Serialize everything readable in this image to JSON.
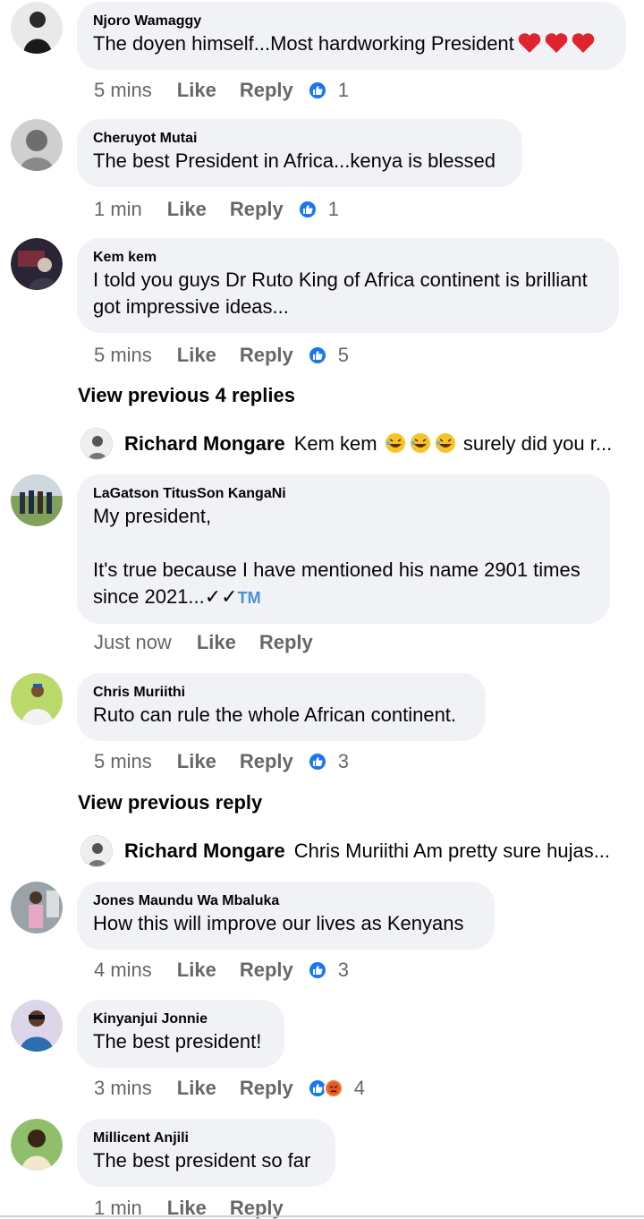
{
  "comments": [
    {
      "name": "Njoro Wamaggy",
      "text": "The doyen himself...Most hardworking President",
      "time": "5 mins",
      "like": "Like",
      "reply": "Reply",
      "reaction_count": "1"
    },
    {
      "name": "Cheruyot Mutai",
      "text": "The best President in Africa...kenya is blessed",
      "time": "1 min",
      "like": "Like",
      "reply": "Reply",
      "reaction_count": "1"
    },
    {
      "name": "Kem kem",
      "text": "I told you guys Dr Ruto King of Africa continent is brilliant got impressive ideas...",
      "time": "5 mins",
      "like": "Like",
      "reply": "Reply",
      "reaction_count": "5"
    },
    {
      "name": "LaGatson TitusSon KangaNi",
      "text": "My president,\n\nIt's true because I have mentioned his name 2901 times since 2021...✓✓",
      "tm": "TM",
      "time": "Just now",
      "like": "Like",
      "reply": "Reply"
    },
    {
      "name": "Chris Muriithi",
      "text": "Ruto can rule the whole African continent.",
      "time": "5 mins",
      "like": "Like",
      "reply": "Reply",
      "reaction_count": "3"
    },
    {
      "name": "Jones Maundu Wa Mbaluka",
      "text": "How  this will improve our lives as Kenyans",
      "time": "4 mins",
      "like": "Like",
      "reply": "Reply",
      "reaction_count": "3"
    },
    {
      "name": "Kinyanjui Jonnie",
      "text": "The best president!",
      "time": "3 mins",
      "like": "Like",
      "reply": "Reply",
      "reaction_count": "4"
    },
    {
      "name": "Millicent Anjili",
      "text": "The best president so far",
      "time": "1 min",
      "like": "Like",
      "reply": "Reply"
    }
  ],
  "view_previous": [
    "View previous 4 replies",
    "View previous reply"
  ],
  "reply_previews": [
    {
      "name": "Richard Mongare",
      "text_before": "Kem kem",
      "text_after": "surely did you r..."
    },
    {
      "name": "Richard Mongare",
      "text_before": "Chris Muriithi Am pretty sure hujas...",
      "text_after": ""
    }
  ],
  "colors": {
    "like_blue": "#1877f2",
    "bubble_bg": "#f0f2f5",
    "meta_gray": "#65676b",
    "heart_red": "#e0242f",
    "angry_orange": "#f57c1f"
  },
  "icons": [
    "heart-icon",
    "thumbs-up-icon",
    "angry-face-icon",
    "laughing-face-icon"
  ]
}
